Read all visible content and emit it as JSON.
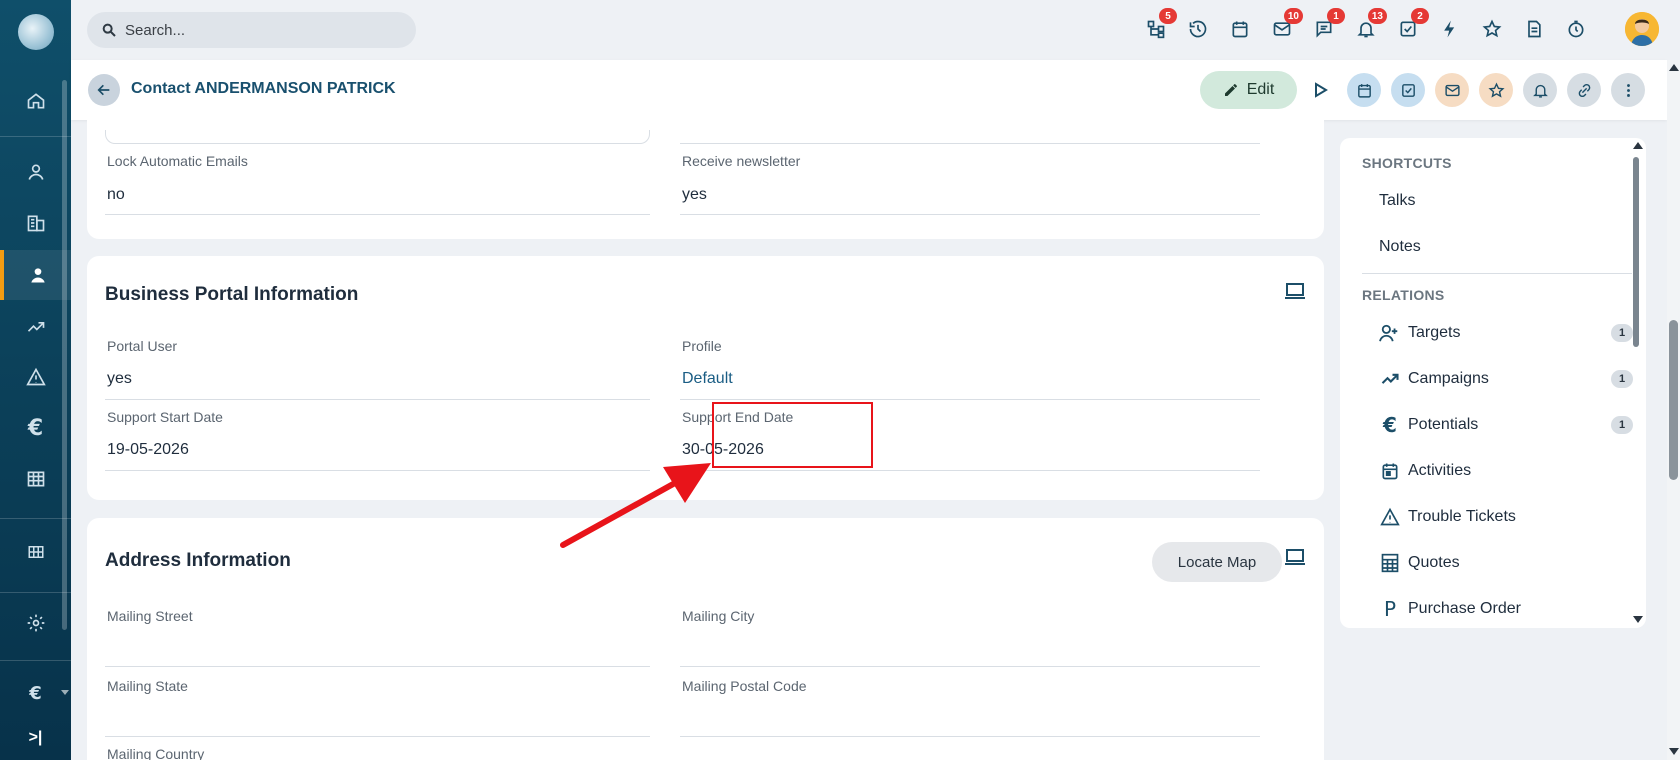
{
  "search": {
    "placeholder": "Search..."
  },
  "topbar": {
    "badges": {
      "hierarchy": "5",
      "mail": "10",
      "chat": "1",
      "bell": "13",
      "tasks": "2"
    }
  },
  "header": {
    "title": "Contact ANDERMANSON PATRICK",
    "edit_label": "Edit"
  },
  "prefs": {
    "lock_label": "Lock Automatic Emails",
    "lock_value": "no",
    "newsletter_label": "Receive newsletter",
    "newsletter_value": "yes"
  },
  "portal": {
    "title": "Business Portal Information",
    "portal_user_label": "Portal User",
    "portal_user_value": "yes",
    "profile_label": "Profile",
    "profile_value": "Default",
    "start_label": "Support Start Date",
    "start_value": "19-05-2026",
    "end_label": "Support End Date",
    "end_value": "30-05-2026"
  },
  "address": {
    "title": "Address Information",
    "locate_label": "Locate Map",
    "street_label": "Mailing Street",
    "city_label": "Mailing City",
    "state_label": "Mailing State",
    "postal_label": "Mailing Postal Code",
    "country_label": "Mailing Country"
  },
  "sidebar": {
    "shortcuts_header": "SHORTCUTS",
    "shortcuts": [
      "Talks",
      "Notes"
    ],
    "relations_header": "RELATIONS",
    "relations": [
      {
        "label": "Targets",
        "count": "1"
      },
      {
        "label": "Campaigns",
        "count": "1"
      },
      {
        "label": "Potentials",
        "count": "1"
      },
      {
        "label": "Activities"
      },
      {
        "label": "Trouble Tickets"
      },
      {
        "label": "Quotes"
      },
      {
        "label": "Purchase Order"
      }
    ]
  },
  "colors": {
    "accent": "#19506e",
    "rail": "#0b3f58",
    "highlight": "#e8141a",
    "active_marker": "#f39c12"
  }
}
